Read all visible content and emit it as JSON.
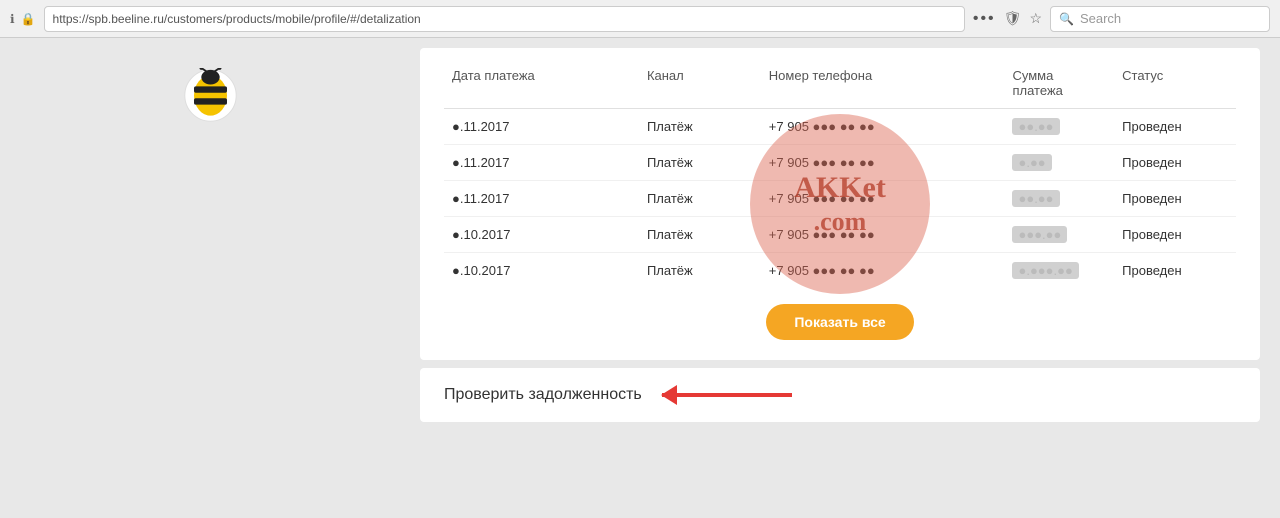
{
  "browser": {
    "url": "https://spb.beeline.ru/customers/products/mobile/profile/#/detalization",
    "search_placeholder": "Search",
    "dots": "•••"
  },
  "table": {
    "headers": {
      "date": "Дата платежа",
      "channel": "Канал",
      "phone": "Номер телефона",
      "amount": "Сумма платежа",
      "status": "Статус"
    },
    "rows": [
      {
        "date": "●.11.2017",
        "channel": "Платёж",
        "phone": "+7 905 ●●● ●● ●●",
        "amount": "●●.●●",
        "status": "Проведен"
      },
      {
        "date": "●.11.2017",
        "channel": "Платёж",
        "phone": "+7 905 ●●● ●● ●●",
        "amount": "●.●●",
        "status": "Проведен"
      },
      {
        "date": "●.11.2017",
        "channel": "Платёж",
        "phone": "+7 905 ●●● ●● ●●",
        "amount": "●●.●●",
        "status": "Проведен"
      },
      {
        "date": "●.10.2017",
        "channel": "Платёж",
        "phone": "+7 905 ●●● ●● ●●",
        "amount": "●●●.●●",
        "status": "Проведен"
      },
      {
        "date": "●.10.2017",
        "channel": "Платёж",
        "phone": "+7 905 ●●● ●● ●●",
        "amount": "●.●●●.●●",
        "status": "Проведен"
      }
    ],
    "show_all_label": "Показать все"
  },
  "debt": {
    "label": "Проверить задолженность"
  },
  "watermark": {
    "line1": "AKKet",
    "line2": ".com"
  }
}
